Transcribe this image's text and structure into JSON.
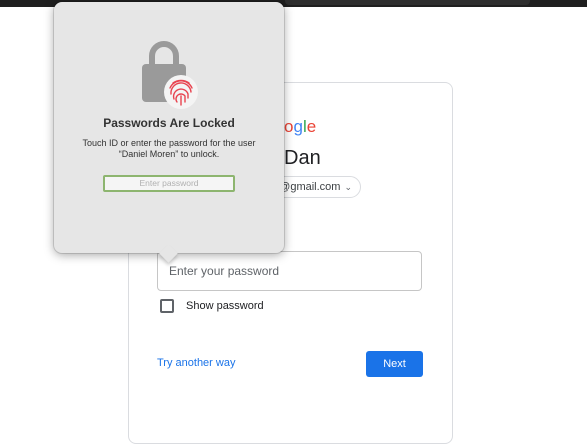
{
  "google_card": {
    "logo_visible_text": "ogle",
    "logo_colors": {
      "o1": "#ea4335",
      "g": "#4285f4",
      "l": "#34a853",
      "e": "#ea4335"
    },
    "greeting": "Dan",
    "account_email_partial": "@gmail.com",
    "password_placeholder": "Enter your password",
    "show_password_label": "Show password",
    "try_another_way": "Try another way",
    "next_button": "Next",
    "accent_color": "#1a73e8"
  },
  "lock_popover": {
    "title": "Passwords Are Locked",
    "message_line1": "Touch ID or enter the password for the user",
    "message_line2": "“Daniel Moren” to unlock.",
    "password_placeholder": "Enter password",
    "icons": [
      "lock-icon",
      "fingerprint-icon"
    ],
    "fingerprint_color": "#e8434f"
  }
}
